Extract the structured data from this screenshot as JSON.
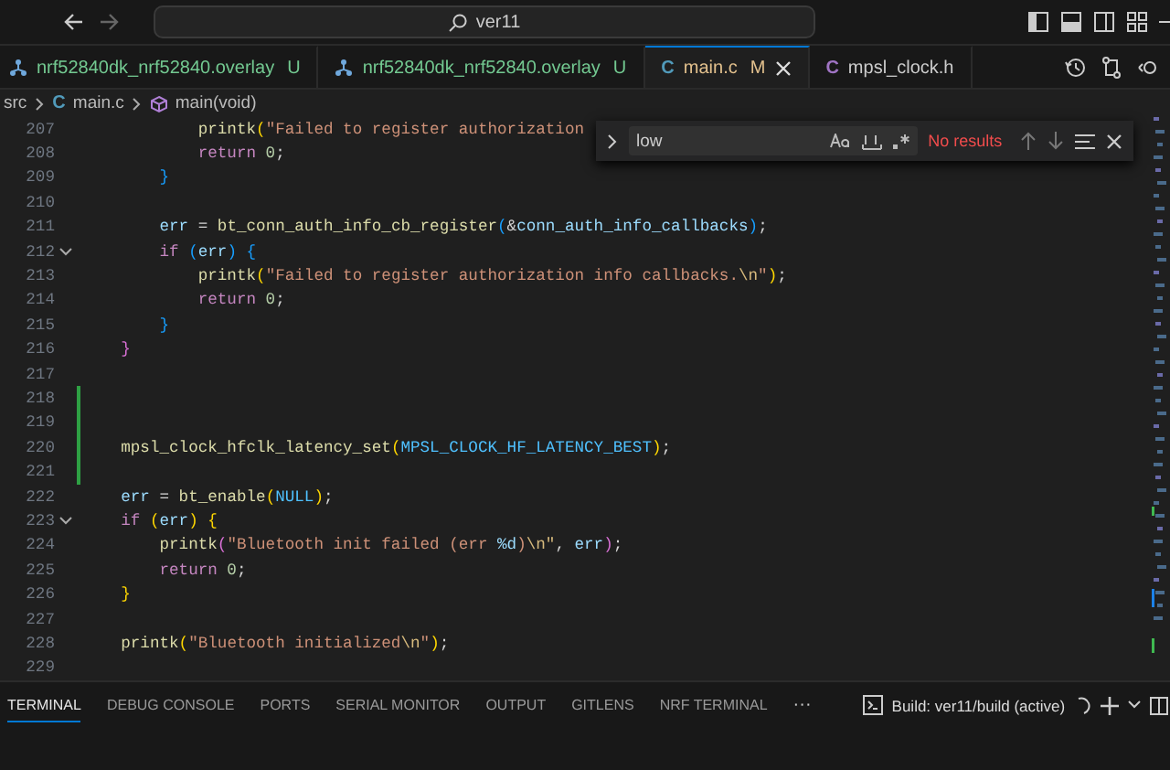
{
  "title_bar": {
    "search": "ver11"
  },
  "tabs": [
    {
      "label": "nrf52840dk_nrf52840.overlay",
      "decoration": "U",
      "kind": "overlay",
      "color": "#73c991",
      "selected": false
    },
    {
      "label": "nrf52840dk_nrf52840.overlay",
      "decoration": "U",
      "kind": "overlay",
      "color": "#73c991",
      "selected": false
    },
    {
      "label": "main.c",
      "decoration": "M",
      "kind": "source",
      "icon_letter": "C",
      "color": "#e2c08d",
      "selected": true
    },
    {
      "label": "mpsl_clock.h",
      "kind": "header",
      "icon_letter": "C",
      "color": "#cccccc",
      "selected": false
    }
  ],
  "breadcrumb": [
    {
      "label": "src",
      "kind": "folder"
    },
    {
      "label": "main.c",
      "kind": "source",
      "icon_letter": "C"
    },
    {
      "label": "main(void)",
      "kind": "function"
    }
  ],
  "find_widget": {
    "value": "low",
    "result": "No results"
  },
  "lines": [
    {
      "number": "207",
      "foldable": false,
      "changed": false,
      "tokens": [
        {
          "t": "            printk",
          "color": "#dcdcaa"
        },
        {
          "t": "(",
          "color": "#ffd700"
        },
        {
          "t": "\"Failed to register authorization",
          "color": "#ce9178"
        }
      ]
    },
    {
      "number": "208",
      "foldable": false,
      "changed": false,
      "tokens": [
        {
          "t": "            return",
          "color": "#c586c0"
        },
        {
          "t": " 0",
          "color": "#b5cea8"
        },
        {
          "t": ";",
          "color": "#d4d4d4"
        }
      ]
    },
    {
      "number": "209",
      "foldable": false,
      "changed": false,
      "tokens": [
        {
          "t": "        }",
          "color": "#179fff"
        }
      ]
    },
    {
      "number": "210",
      "foldable": false,
      "changed": false
    },
    {
      "number": "211",
      "foldable": false,
      "changed": false,
      "tokens": [
        {
          "t": "        err",
          "color": "#9cdcfe"
        },
        {
          "t": " = ",
          "color": "#d4d4d4"
        },
        {
          "t": "bt_conn_auth_info_cb_register",
          "color": "#dcdcaa"
        },
        {
          "t": "(",
          "color": "#179fff"
        },
        {
          "t": "&",
          "color": "#d4d4d4"
        },
        {
          "t": "conn_auth_info_callbacks",
          "color": "#9cdcfe"
        },
        {
          "t": ")",
          "color": "#179fff"
        },
        {
          "t": ";",
          "color": "#d4d4d4"
        }
      ]
    },
    {
      "number": "212",
      "foldable": true,
      "changed": false,
      "tokens": [
        {
          "t": "        if",
          "color": "#c586c0"
        },
        {
          "t": " (",
          "color": "#179fff"
        },
        {
          "t": "err",
          "color": "#9cdcfe"
        },
        {
          "t": ")",
          "color": "#179fff"
        },
        {
          "t": " {",
          "color": "#179fff"
        }
      ]
    },
    {
      "number": "213",
      "foldable": false,
      "changed": false,
      "tokens": [
        {
          "t": "            printk",
          "color": "#dcdcaa"
        },
        {
          "t": "(",
          "color": "#ffd700"
        },
        {
          "t": "\"Failed to register authorization info callbacks.",
          "color": "#ce9178"
        },
        {
          "t": "\\n",
          "color": "#d7ba7d"
        },
        {
          "t": "\"",
          "color": "#ce9178"
        },
        {
          "t": ")",
          "color": "#ffd700"
        },
        {
          "t": ";",
          "color": "#d4d4d4"
        }
      ]
    },
    {
      "number": "214",
      "foldable": false,
      "changed": false,
      "tokens": [
        {
          "t": "            return",
          "color": "#c586c0"
        },
        {
          "t": " 0",
          "color": "#b5cea8"
        },
        {
          "t": ";",
          "color": "#d4d4d4"
        }
      ]
    },
    {
      "number": "215",
      "foldable": false,
      "changed": false,
      "tokens": [
        {
          "t": "        }",
          "color": "#179fff"
        }
      ]
    },
    {
      "number": "216",
      "foldable": false,
      "changed": false,
      "tokens": [
        {
          "t": "    }",
          "color": "#da70d6"
        }
      ]
    },
    {
      "number": "217",
      "foldable": false,
      "changed": false
    },
    {
      "number": "218",
      "foldable": false,
      "changed": true
    },
    {
      "number": "219",
      "foldable": false,
      "changed": true
    },
    {
      "number": "220",
      "foldable": false,
      "changed": true,
      "tokens": [
        {
          "t": "    mpsl_clock_hfclk_latency_set",
          "color": "#dcdcaa"
        },
        {
          "t": "(",
          "color": "#ffd700"
        },
        {
          "t": "MPSL_CLOCK_HF_LATENCY_BEST",
          "color": "#4fc1ff"
        },
        {
          "t": ")",
          "color": "#ffd700"
        },
        {
          "t": ";",
          "color": "#d4d4d4"
        }
      ]
    },
    {
      "number": "221",
      "foldable": false,
      "changed": true
    },
    {
      "number": "222",
      "foldable": false,
      "changed": false,
      "tokens": [
        {
          "t": "    err",
          "color": "#9cdcfe"
        },
        {
          "t": " = ",
          "color": "#d4d4d4"
        },
        {
          "t": "bt_enable",
          "color": "#dcdcaa"
        },
        {
          "t": "(",
          "color": "#ffd700"
        },
        {
          "t": "NULL",
          "color": "#4fc1ff"
        },
        {
          "t": ")",
          "color": "#ffd700"
        },
        {
          "t": ";",
          "color": "#d4d4d4"
        }
      ]
    },
    {
      "number": "223",
      "foldable": true,
      "changed": false,
      "tokens": [
        {
          "t": "    if",
          "color": "#c586c0"
        },
        {
          "t": " (",
          "color": "#ffd700"
        },
        {
          "t": "err",
          "color": "#9cdcfe"
        },
        {
          "t": ")",
          "color": "#ffd700"
        },
        {
          "t": " {",
          "color": "#ffd700"
        }
      ]
    },
    {
      "number": "224",
      "foldable": false,
      "changed": false,
      "tokens": [
        {
          "t": "        printk",
          "color": "#dcdcaa"
        },
        {
          "t": "(",
          "color": "#da70d6"
        },
        {
          "t": "\"Bluetooth init failed (err ",
          "color": "#ce9178"
        },
        {
          "t": "%d",
          "color": "#9cdcfe"
        },
        {
          "t": ")",
          "color": "#ce9178"
        },
        {
          "t": "\\n\"",
          "color": "#d7ba7d"
        },
        {
          "t": ", ",
          "color": "#d4d4d4"
        },
        {
          "t": "err",
          "color": "#9cdcfe"
        },
        {
          "t": ")",
          "color": "#da70d6"
        },
        {
          "t": ";",
          "color": "#d4d4d4"
        }
      ]
    },
    {
      "number": "225",
      "foldable": false,
      "changed": false,
      "tokens": [
        {
          "t": "        return",
          "color": "#c586c0"
        },
        {
          "t": " 0",
          "color": "#b5cea8"
        },
        {
          "t": ";",
          "color": "#d4d4d4"
        }
      ]
    },
    {
      "number": "226",
      "foldable": false,
      "changed": false,
      "tokens": [
        {
          "t": "    }",
          "color": "#ffd700"
        }
      ]
    },
    {
      "number": "227",
      "foldable": false,
      "changed": false
    },
    {
      "number": "228",
      "foldable": false,
      "changed": false,
      "tokens": [
        {
          "t": "    printk",
          "color": "#dcdcaa"
        },
        {
          "t": "(",
          "color": "#ffd700"
        },
        {
          "t": "\"Bluetooth initialized",
          "color": "#ce9178"
        },
        {
          "t": "\\n",
          "color": "#d7ba7d"
        },
        {
          "t": "\"",
          "color": "#ce9178"
        },
        {
          "t": ")",
          "color": "#ffd700"
        },
        {
          "t": ";",
          "color": "#d4d4d4"
        }
      ]
    },
    {
      "number": "229",
      "foldable": false,
      "changed": false
    }
  ],
  "panel": {
    "tabs": [
      {
        "label": "TERMINAL",
        "selected": true
      },
      {
        "label": "DEBUG CONSOLE",
        "selected": false
      },
      {
        "label": "PORTS",
        "selected": false
      },
      {
        "label": "SERIAL MONITOR",
        "selected": false
      },
      {
        "label": "OUTPUT",
        "selected": false
      },
      {
        "label": "GITLENS",
        "selected": false
      },
      {
        "label": "NRF TERMINAL",
        "selected": false
      }
    ],
    "more": "···",
    "terminal_name": "Build: ver11/build (active)"
  }
}
